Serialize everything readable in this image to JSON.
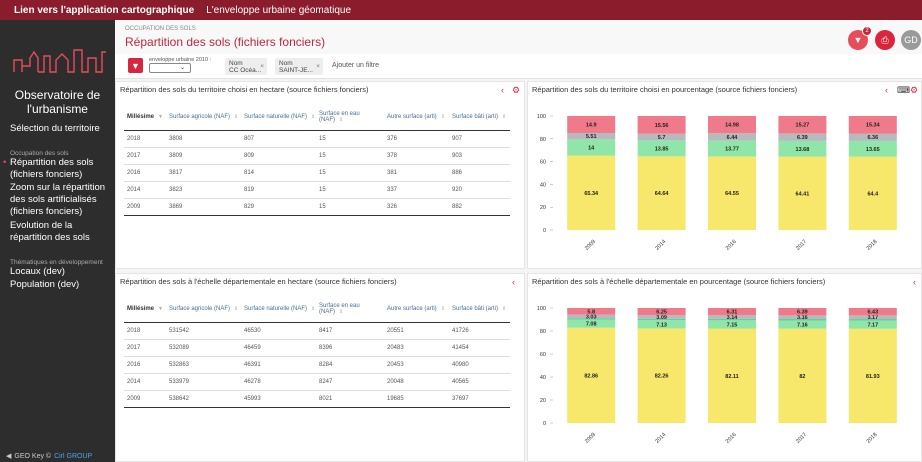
{
  "topbar": {
    "link": "Lien vers l'application cartographique",
    "app": "L'enveloppe urbaine géomatique"
  },
  "sidebar": {
    "title_line1": "Observatoire de",
    "title_line2": "l'urbanisme",
    "select_territory": "Sélection du territoire",
    "cat1": "Occupation des sols",
    "item1a": "Répartition des sols",
    "item1b": "(fichiers fonciers)",
    "item2a": "Zoom sur la répartition",
    "item2b": "des sols artificialisés",
    "item2c": "(fichiers fonciers)",
    "item3a": "Evolution de la",
    "item3b": "répartition des sols",
    "cat2": "Thématiques en développement",
    "item4": "Locaux (dev)",
    "item5": "Population (dev)",
    "footer_brand": "GEO Key ©",
    "footer_link": "Cirl GROUP"
  },
  "header": {
    "subtitle": "OCCUPATION DES SOLS",
    "title": "Répartition des sols (fichiers fonciers)",
    "filter_badge": "2",
    "avatar": "GD"
  },
  "filters": {
    "select_label": "enveloppe urbaine 2010 :",
    "chip1_line1": "Nom",
    "chip1_line2": "CC Océa...",
    "chip2_line1": "Nom",
    "chip2_line2": "SAINT-JE...",
    "remove": "×",
    "add_filter": "Ajouter un filtre"
  },
  "colors": {
    "red": "#f07a8a",
    "grey": "#b7b9bf",
    "green": "#8fe6a8",
    "yellow": "#f7e76a",
    "accent": "#c0283b"
  },
  "columns": [
    "Millésime",
    "Surface agricole (NAF)",
    "Surface naturelle (NAF)",
    "Surface en eau (NAF)",
    "Autre surface (arti)",
    "Surface bâti (arti)"
  ],
  "panels": [
    {
      "title": "Répartition des sols du territoire choisi en hectare (source fichiers fonciers)"
    },
    {
      "title": "Répartition des sols du territoire choisi en pourcentage (source fichiers fonciers)"
    },
    {
      "title": "Répartition des sols à l'échelle départementale en hectare (source fichiers fonciers)"
    },
    {
      "title": "Répartition des sols à l'échelle départementale en pourcentage (source fichiers fonciers)"
    }
  ],
  "table1": [
    [
      "2018",
      "3808",
      "807",
      "15",
      "376",
      "907"
    ],
    [
      "2017",
      "3809",
      "809",
      "15",
      "378",
      "903"
    ],
    [
      "2016",
      "3817",
      "814",
      "15",
      "381",
      "886"
    ],
    [
      "2014",
      "3823",
      "819",
      "15",
      "337",
      "920"
    ],
    [
      "2009",
      "3869",
      "829",
      "15",
      "326",
      "882"
    ]
  ],
  "table2": [
    [
      "2018",
      "531542",
      "46530",
      "8417",
      "20551",
      "41726"
    ],
    [
      "2017",
      "532089",
      "46459",
      "8396",
      "20483",
      "41454"
    ],
    [
      "2016",
      "532863",
      "46391",
      "8284",
      "20453",
      "40980"
    ],
    [
      "2014",
      "533979",
      "46278",
      "8247",
      "20048",
      "40565"
    ],
    [
      "2009",
      "538642",
      "45993",
      "8021",
      "19685",
      "37697"
    ]
  ],
  "chart_data": [
    {
      "type": "bar",
      "stacked": true,
      "categories": [
        "2009",
        "2014",
        "2016",
        "2017",
        "2018"
      ],
      "ylim": [
        0,
        100
      ],
      "yticks": [
        0,
        20,
        40,
        60,
        80,
        100
      ],
      "series": [
        {
          "color": "#f7e76a",
          "values": [
            65.34,
            64.64,
            64.55,
            64.41,
            64.4
          ]
        },
        {
          "color": "#8fe6a8",
          "values": [
            14.0,
            13.85,
            13.77,
            13.68,
            13.65
          ]
        },
        {
          "color": "#5fd19a",
          "values": [
            0.25,
            0.25,
            0.25,
            0.25,
            0.25
          ]
        },
        {
          "color": "#b7b9bf",
          "values": [
            5.51,
            5.7,
            6.44,
            6.39,
            6.36
          ]
        },
        {
          "color": "#f07a8a",
          "values": [
            14.9,
            15.56,
            14.98,
            15.27,
            15.34
          ]
        }
      ]
    },
    {
      "type": "bar",
      "stacked": true,
      "categories": [
        "2009",
        "2014",
        "2016",
        "2017",
        "2018"
      ],
      "ylim": [
        0,
        100
      ],
      "yticks": [
        0,
        20,
        40,
        60,
        80,
        100
      ],
      "series": [
        {
          "color": "#f7e76a",
          "values": [
            82.86,
            82.26,
            82.11,
            82.0,
            81.93
          ]
        },
        {
          "color": "#8fe6a8",
          "values": [
            7.08,
            7.13,
            7.15,
            7.16,
            7.17
          ]
        },
        {
          "color": "#5fd19a",
          "values": [
            1.23,
            1.27,
            1.27,
            1.29,
            1.3
          ]
        },
        {
          "color": "#b7b9bf",
          "values": [
            3.03,
            3.09,
            3.14,
            3.16,
            3.17
          ]
        },
        {
          "color": "#f07a8a",
          "values": [
            5.8,
            6.25,
            6.31,
            6.39,
            6.43
          ]
        }
      ]
    }
  ]
}
